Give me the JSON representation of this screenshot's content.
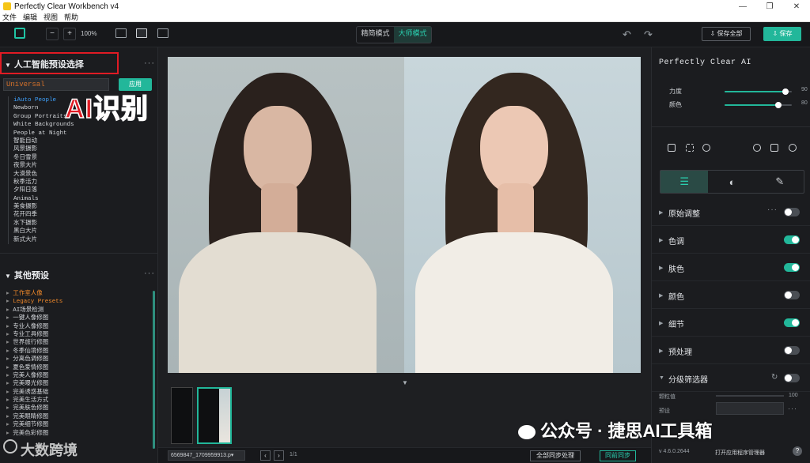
{
  "window": {
    "title": "Perfectly Clear Workbench v4",
    "controls": [
      "—",
      "❐",
      "✕"
    ]
  },
  "menu": [
    "文件",
    "编辑",
    "视图",
    "帮助"
  ],
  "toolbar": {
    "zoom_level": "100%",
    "mode_simple": "精简模式",
    "mode_master": "大师模式",
    "save_all": "保存全部",
    "save": "保存"
  },
  "left": {
    "ai_section_title": "人工智能预设选择",
    "preset_value": "Universal",
    "preset_button": "应用",
    "annotation": "AI识别",
    "ai_presets": [
      "iAuto People",
      "Newborn",
      "Group Portraits",
      "White Backgrounds",
      "People at Night",
      "智能自动",
      "风景摄影",
      "冬日雪景",
      "夜景大片",
      "大漠景色",
      "秋季活力",
      "夕阳日落",
      "Animals",
      "美食摄影",
      "花开四季",
      "水下摄影",
      "黑白大片",
      "新式大片"
    ],
    "other_section_title": "其他预设",
    "other_presets": [
      "工作室人像",
      "Legacy Presets",
      "AI场景检测",
      "一键人像修图",
      "专业人像修图",
      "专业工具修图",
      "世界旅行修图",
      "冬季仙境修图",
      "分离色调修图",
      "夏色爱情修图",
      "完美人像修图",
      "完美曝光修图",
      "完美诱惑基础",
      "完美生活方式",
      "完美肤色修图",
      "完美眼睛修图",
      "完美细节修图",
      "完美色彩修图"
    ]
  },
  "viewer": {
    "filename": "6569847_1709959913.p▾",
    "pager": "1/1",
    "sync_all": "全部同步处理",
    "sync": "同前同步"
  },
  "right": {
    "title": "Perfectly Clear AI",
    "sliders": [
      {
        "label": "力度",
        "value": 90,
        "max": 100
      },
      {
        "label": "颜色",
        "value": 80,
        "max": 100
      }
    ],
    "sections": [
      {
        "label": "原始调整",
        "on": false,
        "dots": true
      },
      {
        "label": "色调",
        "on": true
      },
      {
        "label": "肤色",
        "on": true
      },
      {
        "label": "颜色",
        "on": false
      },
      {
        "label": "细节",
        "on": true
      },
      {
        "label": "预处理",
        "on": false
      },
      {
        "label": "分级筛选器",
        "on": false,
        "refresh": true
      }
    ],
    "sub_row_1": "颗粒值",
    "sub_row_1_value": "100",
    "sub_row_2": "预设",
    "version": "v 4.6.0.2644",
    "open_manager": "打开应用程序管理器",
    "help": "?"
  },
  "watermarks": {
    "wechat": "公众号 · 捷思AI工具箱",
    "dashu": "大数跨境"
  },
  "colors": {
    "accent": "#22b79a",
    "annotation_red": "#e01b24",
    "background": "#151618"
  }
}
